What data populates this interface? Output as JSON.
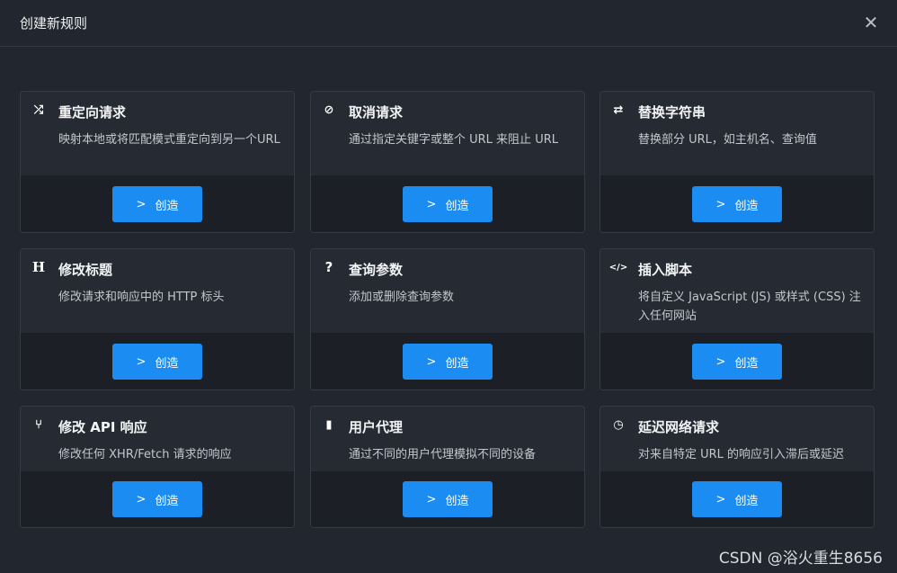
{
  "header": {
    "title": "创建新规则",
    "close_label": "✕"
  },
  "create_label": "创造",
  "cards": [
    {
      "icon": "⤮",
      "title": "重定向请求",
      "desc": "映射本地或将匹配模式重定向到另一个URL"
    },
    {
      "icon": "⊘",
      "title": "取消请求",
      "desc": "通过指定关键字或整个 URL 来阻止 URL"
    },
    {
      "icon": "⇄",
      "title": "替换字符串",
      "desc": "替换部分 URL，如主机名、查询值"
    },
    {
      "icon": "H",
      "title": "修改标题",
      "desc": "修改请求和响应中的 HTTP 标头"
    },
    {
      "icon": "?",
      "title": "查询参数",
      "desc": "添加或删除查询参数"
    },
    {
      "icon": "</>",
      "title": "插入脚本",
      "desc": "将自定义 JavaScript (JS) 或样式 (CSS) 注入任何网站"
    },
    {
      "icon": "⑂",
      "title": "修改 API 响应",
      "desc": "修改任何 XHR/Fetch 请求的响应"
    },
    {
      "icon": "▮",
      "title": "用户代理",
      "desc": "通过不同的用户代理模拟不同的设备"
    },
    {
      "icon": "◷",
      "title": "延迟网络请求",
      "desc": "对来自特定 URL 的响应引入滞后或延迟"
    }
  ],
  "watermark": "CSDN @浴火重生8656"
}
